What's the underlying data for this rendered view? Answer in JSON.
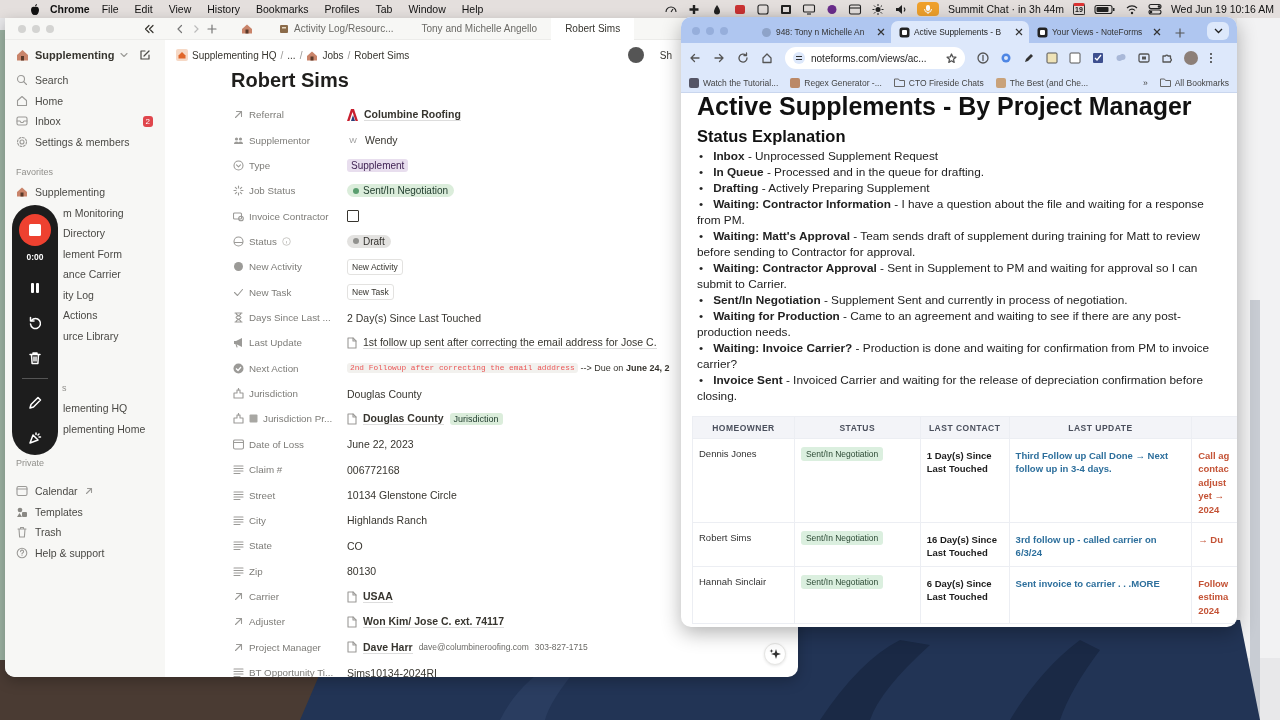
{
  "menu_bar": {
    "app": "Chrome",
    "menus": [
      "File",
      "Edit",
      "View",
      "History",
      "Bookmarks",
      "Profiles",
      "Tab",
      "Window",
      "Help"
    ],
    "event": "Summit Chat · in 3h 44m",
    "calendar_day": "19",
    "clock": "Wed Jun 19  10:16 AM"
  },
  "notion": {
    "tabs": [
      {
        "label": "Activity Log/Resourc...",
        "selected": false
      },
      {
        "label": "Tony and Michelle Angello",
        "selected": false
      },
      {
        "label": "Robert Sims",
        "selected": true
      }
    ],
    "workspace": "Supplementing",
    "sidebar": {
      "top": [
        {
          "label": "Search",
          "kind": "search"
        },
        {
          "label": "Home",
          "kind": "home"
        },
        {
          "label": "Inbox",
          "kind": "inbox",
          "badge": "2"
        },
        {
          "label": "Settings & members",
          "kind": "settings"
        }
      ],
      "sections": [
        {
          "title": "Favorites",
          "kind": "plain",
          "items": [
            {
              "label": "Supplementing",
              "kind": "page"
            },
            {
              "label": "m Monitoring",
              "kind": "covered"
            },
            {
              "label": "Directory",
              "kind": "covered"
            },
            {
              "label": "lement Form",
              "kind": "covered"
            },
            {
              "label": "ance Carrier",
              "kind": "covered"
            },
            {
              "label": "ity Log",
              "kind": "covered"
            },
            {
              "label": "Actions",
              "kind": "covered"
            },
            {
              "label": "urce Library",
              "kind": "covered"
            }
          ]
        },
        {
          "title": "s",
          "kind": "covered",
          "items": [
            {
              "label": "lementing HQ",
              "kind": "covered"
            },
            {
              "label": "plementing Home",
              "kind": "covered"
            }
          ]
        },
        {
          "title": "Private",
          "kind": "plain",
          "items": [
            {
              "label": "Calendar",
              "kind": "calendar"
            },
            {
              "label": "Templates",
              "kind": "templates"
            },
            {
              "label": "Trash",
              "kind": "trash"
            },
            {
              "label": "Help & support",
              "kind": "help"
            }
          ]
        }
      ]
    },
    "breadcrumb": [
      "Supplementing HQ",
      "...",
      "Jobs",
      "Robert Sims"
    ],
    "breadcrumb_separators": [
      "/",
      "/",
      "/"
    ],
    "share": "Sh",
    "title": "Robert Sims",
    "properties": [
      {
        "label": "Referral",
        "kind": "company",
        "value": "Columbine Roofing"
      },
      {
        "label": "Supplementor",
        "kind": "person",
        "initial": "W",
        "value": "Wendy"
      },
      {
        "label": "Type",
        "kind": "select",
        "value": "Supplement"
      },
      {
        "label": "Job Status",
        "kind": "status",
        "value": "Sent/In Negotiation"
      },
      {
        "label": "Invoice Contractor",
        "kind": "checkbox",
        "checked": false
      },
      {
        "label": "Status",
        "kind": "state",
        "value": "Draft"
      },
      {
        "label": "New Activity",
        "kind": "activity",
        "value": "New Activity"
      },
      {
        "label": "New Task",
        "kind": "task",
        "value": "New Task"
      },
      {
        "label": "Days Since Last ...",
        "kind": "formula",
        "value": "2 Day(s) Since Last Touched"
      },
      {
        "label": "Last Update",
        "kind": "note",
        "value": "1st follow up sent after correcting the email address for Jose C."
      },
      {
        "label": "Next Action",
        "kind": "action",
        "code": "2nd Followup after correcting the email adddress",
        "value": "--> Due on **June 24, 2**"
      },
      {
        "label": "Jurisdiction",
        "kind": "place",
        "value": "Douglas County"
      },
      {
        "label": "Jurisdiction Pr...",
        "kind": "rollup",
        "value": "Douglas County",
        "tag": "Jurisdiction"
      },
      {
        "label": "Date of Loss",
        "kind": "date",
        "value": "June 22, 2023"
      },
      {
        "label": "Claim #",
        "kind": "text",
        "value": "006772168"
      },
      {
        "label": "Street",
        "kind": "text",
        "value": "10134 Glenstone Circle"
      },
      {
        "label": "City",
        "kind": "text",
        "value": "Highlands Ranch"
      },
      {
        "label": "State",
        "kind": "text",
        "value": "CO"
      },
      {
        "label": "Zip",
        "kind": "text",
        "value": "80130"
      },
      {
        "label": "Carrier",
        "kind": "link",
        "value": "USAA"
      },
      {
        "label": "Adjuster",
        "kind": "link",
        "value": "Won Kim/ Jose C. ext. 74117"
      },
      {
        "label": "Project Manager",
        "kind": "link",
        "value": "Dave Harr",
        "extras": [
          "dave@columbineroofing.com",
          "303-827-1715"
        ]
      },
      {
        "label": "BT Opportunity Ti...",
        "kind": "text",
        "value": "Sims10134-2024RI"
      }
    ]
  },
  "recorder": {
    "time": "0:00"
  },
  "browser": {
    "tabs": [
      {
        "label": "948: Tony n Michelle An",
        "selected": false
      },
      {
        "label": "Active Supplements - B",
        "selected": true
      },
      {
        "label": "Your Views - NoteForms",
        "selected": false
      }
    ],
    "url": "noteforms.com/views/ac...",
    "bookmarks": [
      "Watch the Tutorial...",
      "Regex Generator -...",
      "CTO Fireside Chats",
      "The Best (and Che..."
    ],
    "more": "»",
    "all_bookmarks": "All Bookmarks",
    "heading": "Active Supplements - By Project Manager",
    "subheading": "Status Explanation",
    "statuses": [
      {
        "bullet": "•",
        "text": "**Inbox** - Unprocessed Supplement Request"
      },
      {
        "bullet": "•",
        "text": "**In Queue** - Processed and in the queue for drafting."
      },
      {
        "bullet": "•",
        "text": "**Drafting** - Actively Preparing Supplement"
      },
      {
        "bullet": "•",
        "text": "**Waiting: Contractor Information** - I have a question about the file and waiting for a response from PM."
      },
      {
        "bullet": "•",
        "text": "**Waiting: Matt's Approval** - Team sends draft of supplement during training for Matt to review before sending to Contractor for approval."
      },
      {
        "bullet": "•",
        "text": "**Waiting: Contractor Approval** - Sent in Supplement to PM and waiting for approval so I can submit to Carrier."
      },
      {
        "bullet": "•",
        "text": "**Sent/In Negotiation** - Supplement Sent and currently in process of negotiation."
      },
      {
        "bullet": "•",
        "text": "**Waiting for Production** - Came to an agreement and waiting to see if there are any post-production needs."
      },
      {
        "bullet": "•",
        "text": "**Waiting: Invoice Carrier?** - Production is done and waiting for confirmation from PM to invoice carrier?"
      },
      {
        "bullet": "•",
        "text": "**Invoice Sent** - Invoiced Carrier and waiting for the release of depreciation confirmation before closing."
      }
    ],
    "table": {
      "columns": [
        "HOMEOWNER",
        "STATUS",
        "LAST CONTACT",
        "LAST UPDATE"
      ],
      "rows": [
        {
          "homeowner": "Dennis Jones",
          "status": "Sent/In Negotiation",
          "last_contact": "1 Day(s) Since Last Touched",
          "last_update": "Third Follow up Call Done → Next follow up in 3-4 days.",
          "column_5": [
            "Call ag",
            "contac",
            "adjust",
            "yet →",
            "2024"
          ]
        },
        {
          "homeowner": "Robert Sims",
          "status": "Sent/In Negotiation",
          "last_contact": "16 Day(s) Since Last Touched",
          "last_update": "3rd follow up - called carrier on 6/3/24",
          "column_5": [
            "→ Du"
          ]
        },
        {
          "homeowner": "Hannah Sinclair",
          "status": "Sent/In Negotiation",
          "last_contact": "6 Day(s) Since Last Touched",
          "last_update": "Sent invoice to carrier . . .MORE",
          "column_5": [
            "Follow",
            "estima",
            "2024"
          ]
        }
      ]
    }
  }
}
